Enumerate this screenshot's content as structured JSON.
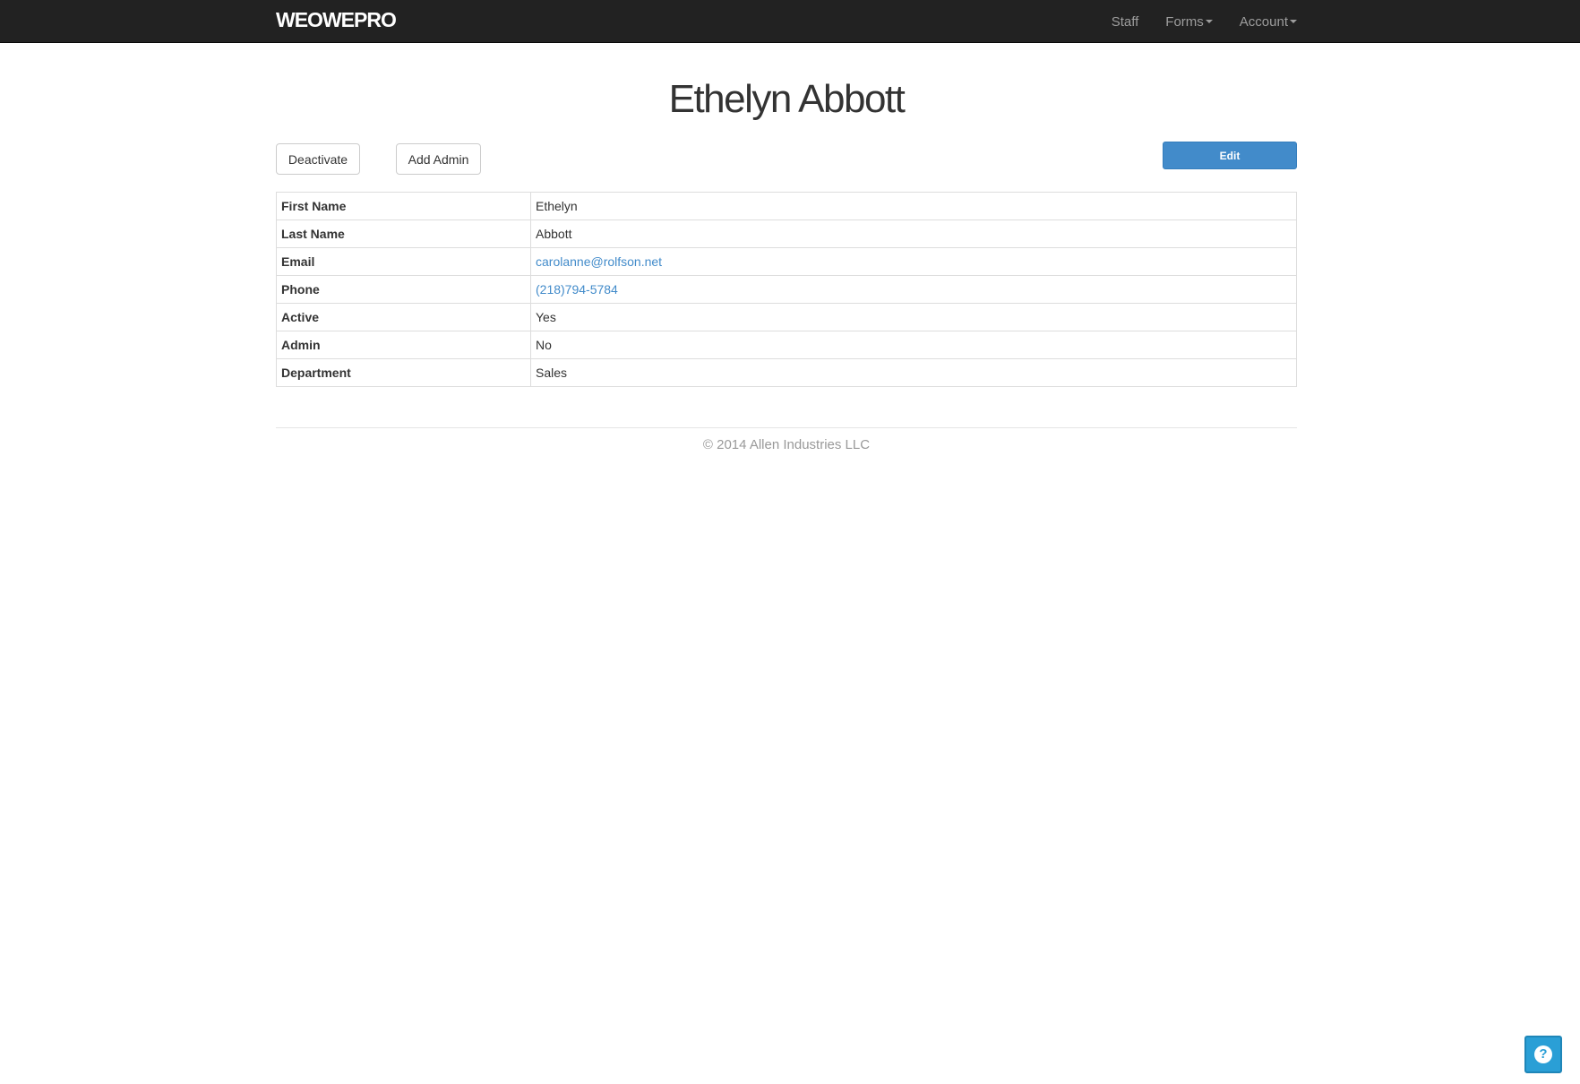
{
  "navbar": {
    "brand": "WEOWEPRO",
    "items": [
      {
        "label": "Staff",
        "has_caret": false
      },
      {
        "label": "Forms",
        "has_caret": true
      },
      {
        "label": "Account",
        "has_caret": true
      }
    ]
  },
  "page": {
    "title": "Ethelyn Abbott"
  },
  "actions": {
    "deactivate_label": "Deactivate",
    "add_admin_label": "Add Admin",
    "edit_label": "Edit"
  },
  "details": [
    {
      "label": "First Name",
      "value": "Ethelyn",
      "link": false
    },
    {
      "label": "Last Name",
      "value": "Abbott",
      "link": false
    },
    {
      "label": "Email",
      "value": "carolanne@rolfson.net",
      "link": true
    },
    {
      "label": "Phone",
      "value": "(218)794-5784",
      "link": true
    },
    {
      "label": "Active",
      "value": "Yes",
      "link": false
    },
    {
      "label": "Admin",
      "value": "No",
      "link": false
    },
    {
      "label": "Department",
      "value": "Sales",
      "link": false
    }
  ],
  "footer": {
    "text": "© 2014 Allen Industries LLC"
  },
  "help": {
    "icon": "question-circle-icon",
    "glyph": "?"
  },
  "colors": {
    "navbar_bg": "#222222",
    "primary": "#428bca",
    "help_bg": "#2a9fd6"
  }
}
